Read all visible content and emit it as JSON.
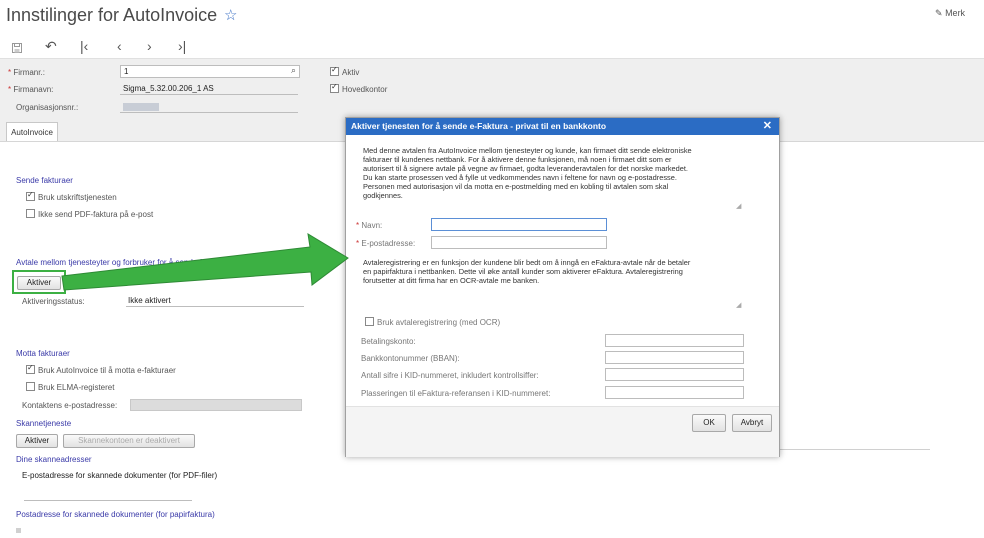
{
  "page": {
    "title": "Innstilinger for AutoInvoice",
    "notes_label": "Merk"
  },
  "icons": {
    "star": "star-icon",
    "notes": "edit-note-icon",
    "save": "save-icon",
    "undo": "undo-icon",
    "first": "first-record-icon",
    "prev": "previous-record-icon",
    "next": "next-record-icon",
    "last": "last-record-icon",
    "lookup": "search-icon"
  },
  "header": {
    "firmanr_label": "Firmanr.:",
    "firmanr_value": "1",
    "firmanavn_label": "Firmanavn:",
    "firmanavn_value": "Sigma_5.32.00.206_1 AS",
    "orgnr_label": "Organisasjonsnr.:",
    "aktiv_label": "Aktiv",
    "hovedkontor_label": "Hovedkontor"
  },
  "tabs": [
    {
      "label": "AutoInvoice",
      "active": true
    }
  ],
  "sende": {
    "title": "Sende fakturaer",
    "bruk_label": "Bruk utskriftstjenesten",
    "bruk_checked": true,
    "ikke_pdf_label": "Ikke send PDF-faktura på e-post",
    "ikke_pdf_checked": false
  },
  "avtale": {
    "title": "Avtale mellom tjenesteyter og forbruker for å sende forbrukers e-faktura til banke",
    "aktiver_label": "Aktiver",
    "status_label": "Aktiveringsstatus:",
    "status_value": "Ikke aktivert"
  },
  "motta": {
    "title": "Motta fakturaer",
    "bruk_label": "Bruk AutoInvoice til å motta e-fakturaer",
    "bruk_checked": true,
    "elma_label": "Bruk ELMA-registeret",
    "elma_checked": false,
    "kontakt_label": "Kontaktens e-postadresse:"
  },
  "skann": {
    "title": "Skannetjeneste",
    "aktiver_label": "Aktiver",
    "deaktivert_label": "Skannekontoen er deaktivert",
    "adresser_title": "Dine skanneadresser",
    "epost_label": "E-postadresse for skannede dokumenter (for PDF-filer)",
    "post_title": "Postadresse for skannede dokumenter (for papirfaktura)"
  },
  "modal": {
    "title": "Aktiver tjenesten for å sende e-Faktura - privat til en bankkonto",
    "intro_lines": [
      "Med denne avtalen fra AutoInvoice mellom tjenesteyter og kunde, kan firmaet ditt sende elektroniske",
      "fakturaer til kundenes nettbank. For å aktivere denne funksjonen, må noen i firmaet ditt som er",
      "autorisert til å signere avtale på vegne av firmaet, godta leveranderavtalen for det norske markedet.",
      "Du kan starte prosessen ved å fylle ut vedkommendes navn i feltene for navn og e-postadresse.",
      "Personen med autorisasjon vil da motta en e-postmelding med en kobling til avtalen som skal",
      "godkjennes."
    ],
    "navn_label": "Navn:",
    "epost_label": "E-postadresse:",
    "avtale_lines": [
      "Avtaleregistrering er en funksjon der kundene blir bedt om å inngå en eFaktura-avtale når de betaler",
      "en papirfaktura i nettbanken. Dette vil øke antall kunder som aktiverer eFaktura. Avtaleregistrering",
      "forutsetter at ditt firma har en OCR-avtale me banken."
    ],
    "ocr_label": "Bruk avtaleregistrering (med OCR)",
    "ocr_checked": false,
    "fields": [
      "Betalingskonto:",
      "Bankkontonummer (BBAN):",
      "Antall sifre i KID-nummeret, inkludert kontrollsiffer:",
      "Plasseringen til eFaktura-referansen i KID-nummeret:"
    ],
    "ok_label": "OK",
    "cancel_label": "Avbryt"
  },
  "colors": {
    "accent": "#2b6cc4",
    "arrow": "#3cb043",
    "section": "#3a3aa8"
  }
}
